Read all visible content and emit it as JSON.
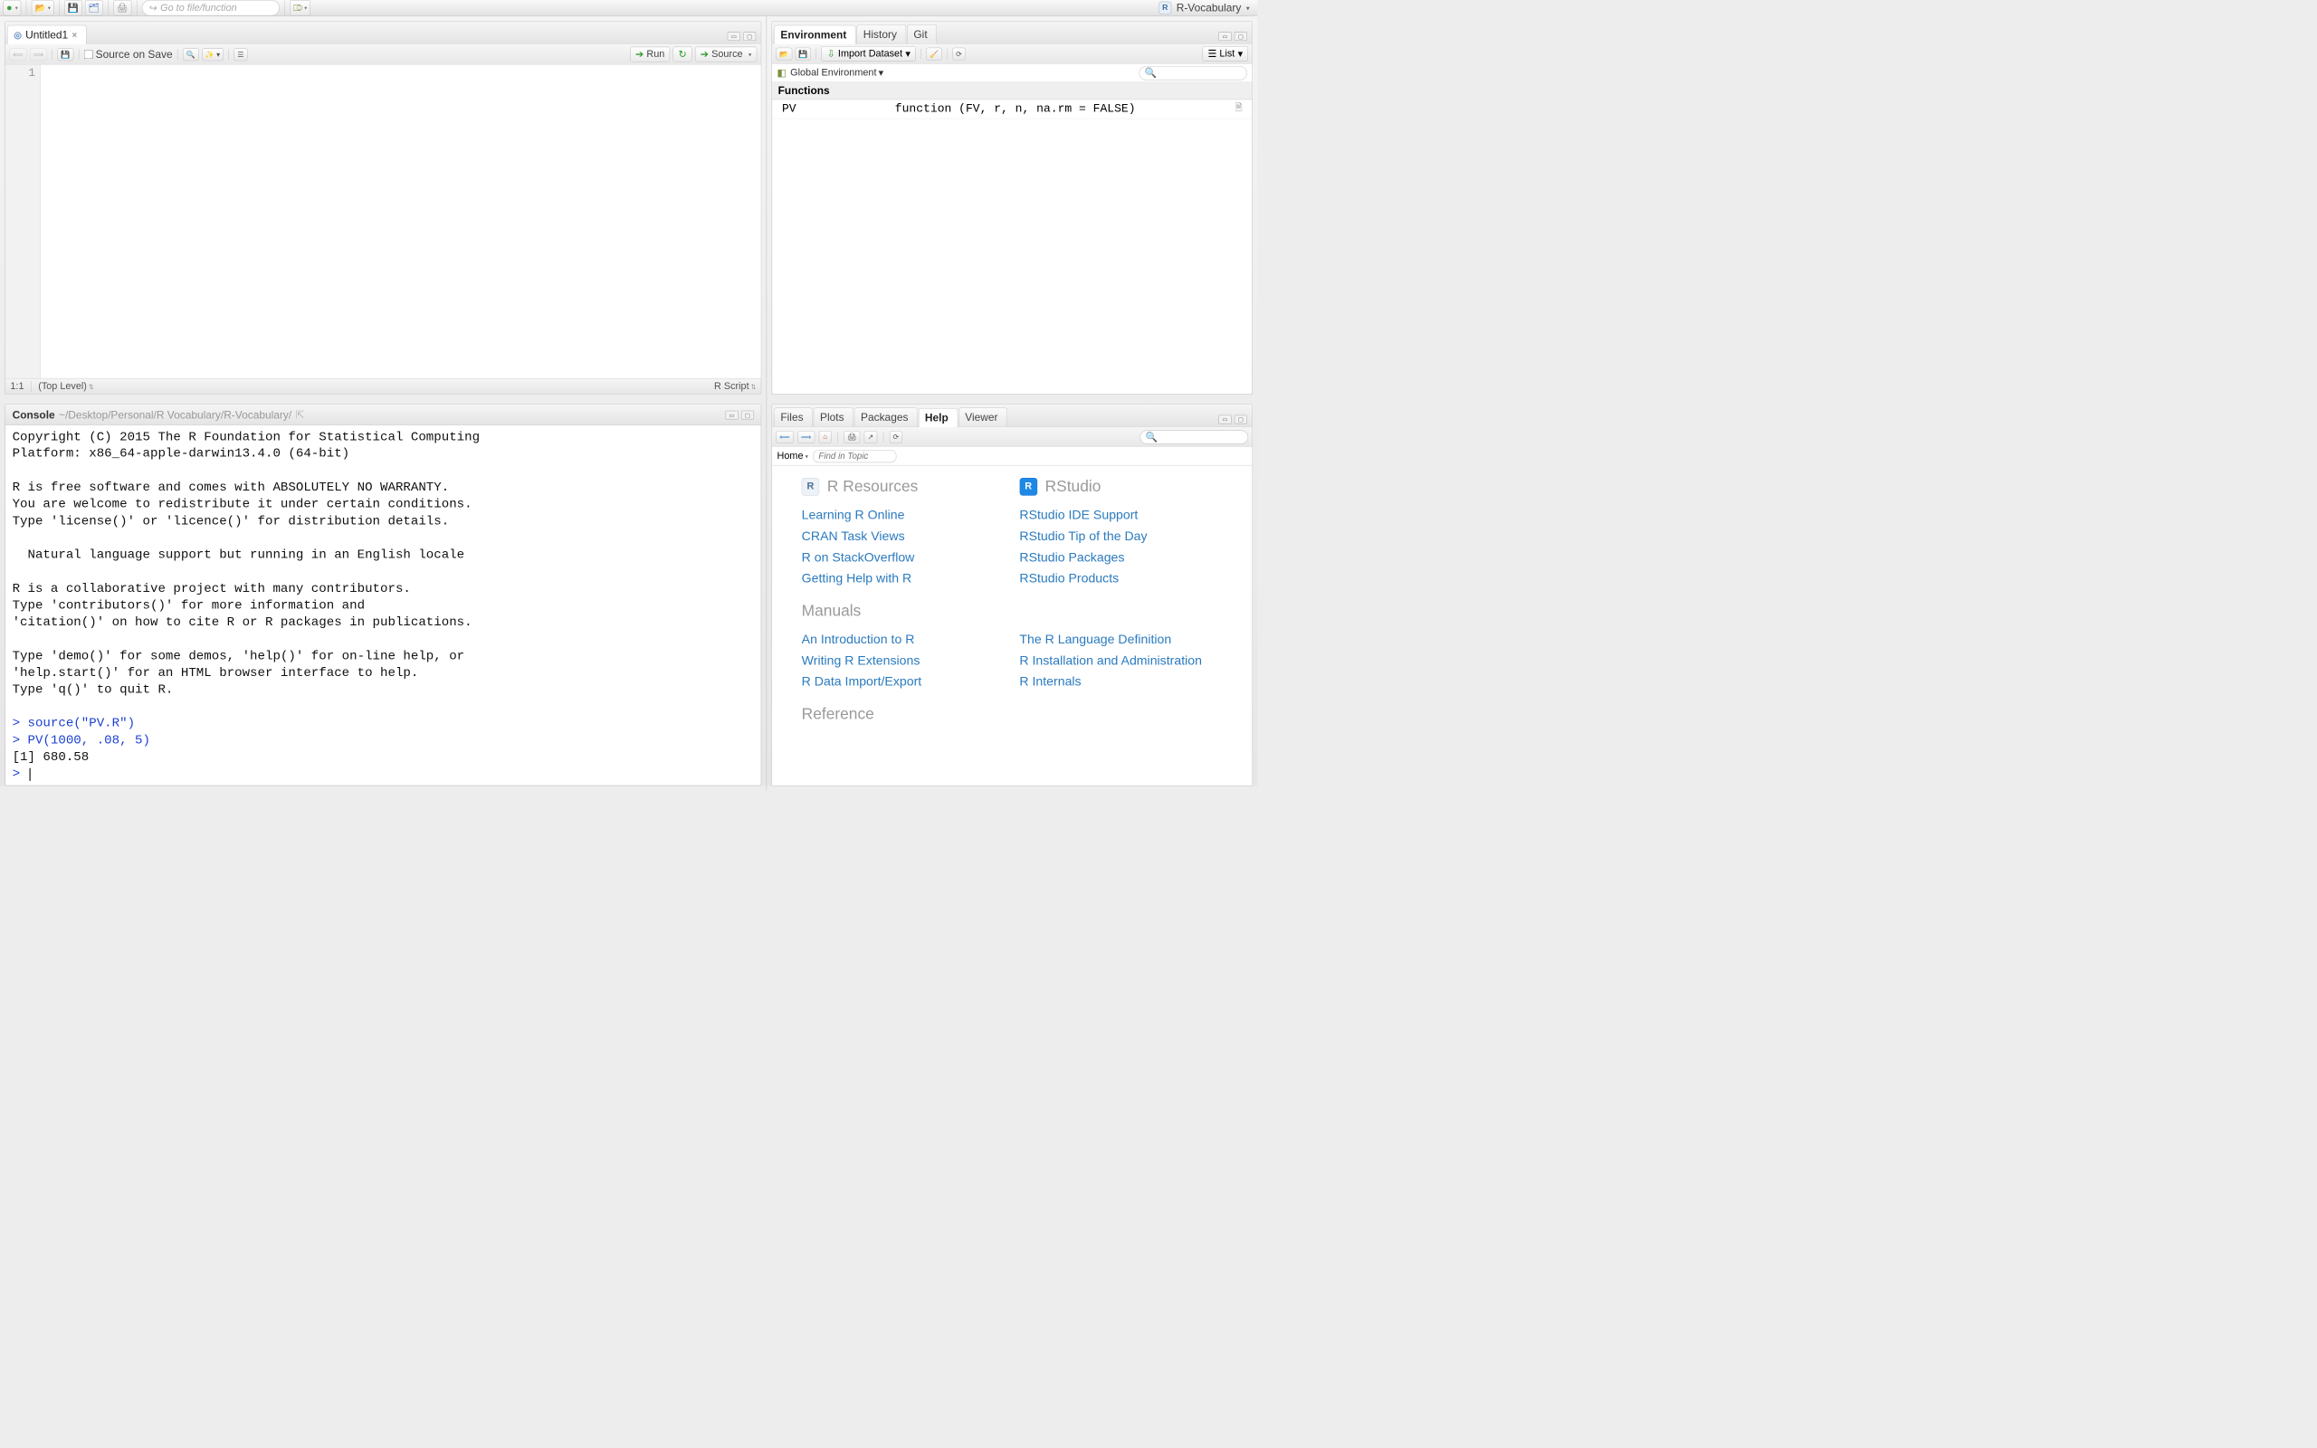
{
  "topbar": {
    "goto_placeholder": "Go to file/function",
    "project_name": "R-Vocabulary"
  },
  "source": {
    "tab_title": "Untitled1",
    "source_on_save": "Source on Save",
    "run_label": "Run",
    "source_label": "Source",
    "gutter_line": "1",
    "status_pos": "1:1",
    "status_scope": "(Top Level)",
    "status_lang": "R Script"
  },
  "console": {
    "title": "Console",
    "path": "~/Desktop/Personal/R Vocabulary/R-Vocabulary/",
    "lines": [
      "Copyright (C) 2015 The R Foundation for Statistical Computing",
      "Platform: x86_64-apple-darwin13.4.0 (64-bit)",
      "",
      "R is free software and comes with ABSOLUTELY NO WARRANTY.",
      "You are welcome to redistribute it under certain conditions.",
      "Type 'license()' or 'licence()' for distribution details.",
      "",
      "  Natural language support but running in an English locale",
      "",
      "R is a collaborative project with many contributors.",
      "Type 'contributors()' for more information and",
      "'citation()' on how to cite R or R packages in publications.",
      "",
      "Type 'demo()' for some demos, 'help()' for on-line help, or",
      "'help.start()' for an HTML browser interface to help.",
      "Type 'q()' to quit R.",
      ""
    ],
    "cmd1": "> source(\"PV.R\")",
    "cmd2": "> PV(1000, .08, 5)",
    "out1": "[1] 680.58",
    "prompt": "> "
  },
  "env": {
    "tabs": [
      "Environment",
      "History",
      "Git"
    ],
    "import_label": "Import Dataset",
    "list_label": "List",
    "scope": "Global Environment",
    "section": "Functions",
    "fn_name": "PV",
    "fn_sig": "function (FV, r, n, na.rm = FALSE)"
  },
  "help": {
    "tabs": [
      "Files",
      "Plots",
      "Packages",
      "Help",
      "Viewer"
    ],
    "home_label": "Home",
    "find_placeholder": "Find in Topic",
    "sections": {
      "r_resources": "R Resources",
      "r_links": [
        "Learning R Online",
        "CRAN Task Views",
        "R on StackOverflow",
        "Getting Help with R"
      ],
      "rstudio": "RStudio",
      "rs_links": [
        "RStudio IDE Support",
        "RStudio Tip of the Day",
        "RStudio Packages",
        "RStudio Products"
      ],
      "manuals": "Manuals",
      "man_links_l": [
        "An Introduction to R",
        "Writing R Extensions",
        "R Data Import/Export"
      ],
      "man_links_r": [
        "The R Language Definition",
        "R Installation and Administration",
        "R Internals"
      ],
      "reference": "Reference"
    }
  }
}
